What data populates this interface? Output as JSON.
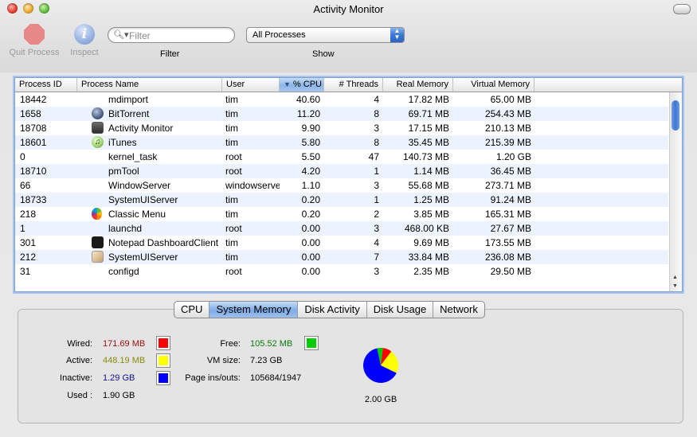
{
  "window": {
    "title": "Activity Monitor"
  },
  "toolbar": {
    "quit_label": "Quit Process",
    "inspect_label": "Inspect",
    "filter_placeholder": "Filter",
    "filter_label": "Filter",
    "show_value": "All Processes",
    "show_label": "Show"
  },
  "table": {
    "columns": [
      "Process ID",
      "Process Name",
      "User",
      "% CPU",
      "# Threads",
      "Real Memory",
      "Virtual Memory"
    ],
    "sorted_column": "% CPU",
    "rows": [
      {
        "pid": "18442",
        "name": "mdimport",
        "icon": "",
        "user": "tim",
        "cpu": "40.60",
        "threads": "4",
        "real": "17.82 MB",
        "virtual": "65.00 MB"
      },
      {
        "pid": "1658",
        "name": "BitTorrent",
        "icon": "bittorrent-icon",
        "user": "tim",
        "cpu": "11.20",
        "threads": "8",
        "real": "69.71 MB",
        "virtual": "254.43 MB"
      },
      {
        "pid": "18708",
        "name": "Activity Monitor",
        "icon": "activity-monitor-icon",
        "user": "tim",
        "cpu": "9.90",
        "threads": "3",
        "real": "17.15 MB",
        "virtual": "210.13 MB"
      },
      {
        "pid": "18601",
        "name": "iTunes",
        "icon": "itunes-icon",
        "user": "tim",
        "cpu": "5.80",
        "threads": "8",
        "real": "35.45 MB",
        "virtual": "215.39 MB"
      },
      {
        "pid": "0",
        "name": "kernel_task",
        "icon": "",
        "user": "root",
        "cpu": "5.50",
        "threads": "47",
        "real": "140.73 MB",
        "virtual": "1.20 GB"
      },
      {
        "pid": "18710",
        "name": "pmTool",
        "icon": "",
        "user": "root",
        "cpu": "4.20",
        "threads": "1",
        "real": "1.14 MB",
        "virtual": "36.45 MB"
      },
      {
        "pid": "66",
        "name": "WindowServer",
        "icon": "",
        "user": "windowserve",
        "cpu": "1.10",
        "threads": "3",
        "real": "55.68 MB",
        "virtual": "273.71 MB"
      },
      {
        "pid": "18733",
        "name": "SystemUIServer",
        "icon": "",
        "user": "tim",
        "cpu": "0.20",
        "threads": "1",
        "real": "1.25 MB",
        "virtual": "91.24 MB"
      },
      {
        "pid": "218",
        "name": "Classic Menu",
        "icon": "apple-icon",
        "user": "tim",
        "cpu": "0.20",
        "threads": "2",
        "real": "3.85 MB",
        "virtual": "165.31 MB"
      },
      {
        "pid": "1",
        "name": "launchd",
        "icon": "",
        "user": "root",
        "cpu": "0.00",
        "threads": "3",
        "real": "468.00 KB",
        "virtual": "27.67 MB"
      },
      {
        "pid": "301",
        "name": "Notepad DashboardClient",
        "icon": "dashboard-icon",
        "user": "tim",
        "cpu": "0.00",
        "threads": "4",
        "real": "9.69 MB",
        "virtual": "173.55 MB"
      },
      {
        "pid": "212",
        "name": "SystemUIServer",
        "icon": "systemuiserver-icon",
        "user": "tim",
        "cpu": "0.00",
        "threads": "7",
        "real": "33.84 MB",
        "virtual": "236.08 MB"
      },
      {
        "pid": "31",
        "name": "configd",
        "icon": "",
        "user": "root",
        "cpu": "0.00",
        "threads": "3",
        "real": "2.35 MB",
        "virtual": "29.50 MB"
      }
    ]
  },
  "tabs": [
    "CPU",
    "System Memory",
    "Disk Activity",
    "Disk Usage",
    "Network"
  ],
  "active_tab": "System Memory",
  "memory": {
    "wired": {
      "label": "Wired:",
      "value": "171.69 MB",
      "color": "#ff0000"
    },
    "active": {
      "label": "Active:",
      "value": "448.19 MB",
      "color": "#ffff00"
    },
    "inactive": {
      "label": "Inactive:",
      "value": "1.29 GB",
      "color": "#0000ff"
    },
    "used": {
      "label": "Used :",
      "value": "1.90 GB"
    },
    "free": {
      "label": "Free:",
      "value": "105.52 MB",
      "color": "#00cc00"
    },
    "vm_size": {
      "label": "VM size:",
      "value": "7.23 GB"
    },
    "page_ins_outs": {
      "label": "Page ins/outs:",
      "value": "105684/1947"
    },
    "total": "2.00 GB",
    "pie_mb": {
      "wired": 171.69,
      "active": 448.19,
      "inactive": 1320.96,
      "free": 105.52
    }
  }
}
